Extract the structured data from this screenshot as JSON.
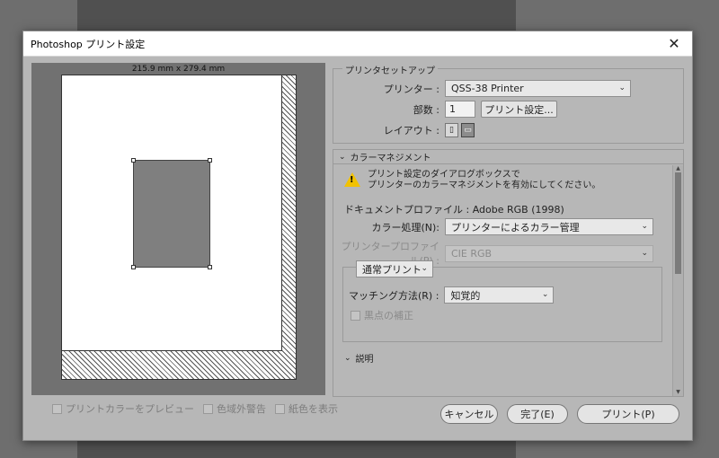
{
  "window": {
    "title": "Photoshop プリント設定",
    "close_glyph": "✕"
  },
  "preview": {
    "paper_size": "215.9 mm x 279.4 mm"
  },
  "bottom_checks": [
    {
      "label": "プリントカラーをプレビュー",
      "checked": false
    },
    {
      "label": "色域外警告",
      "checked": false
    },
    {
      "label": "紙色を表示",
      "checked": false
    }
  ],
  "printer_setup": {
    "legend": "プリンタセットアップ",
    "printer_label": "プリンター :",
    "printer_value": "QSS-38 Printer",
    "copies_label": "部数 :",
    "copies_value": "1",
    "print_settings_button": "プリント設定...",
    "layout_label": "レイアウト :"
  },
  "color_management": {
    "header": "カラーマネジメント",
    "warning_line1": "プリント設定のダイアログボックスで",
    "warning_line2": "プリンターのカラーマネジメントを有効にしてください。",
    "doc_profile": "ドキュメントプロファイル : Adobe RGB (1998)",
    "color_handling_label": "カラー処理(N):",
    "color_handling_value": "プリンターによるカラー管理",
    "printer_profile_label": "プリンタープロファイル(P) :",
    "printer_profile_value": "CIE RGB",
    "normal_print_value": "通常プリント",
    "matching_label": "マッチング方法(R) :",
    "matching_value": "知覚的",
    "black_point_label": "黒点の補正",
    "description_header": "説明"
  },
  "buttons": {
    "cancel": "キャンセル",
    "done": "完了(E)",
    "print": "プリント(P)"
  },
  "colors": {
    "dialog_bg": "#b7b7b7",
    "warning_yellow": "#f2c200"
  }
}
